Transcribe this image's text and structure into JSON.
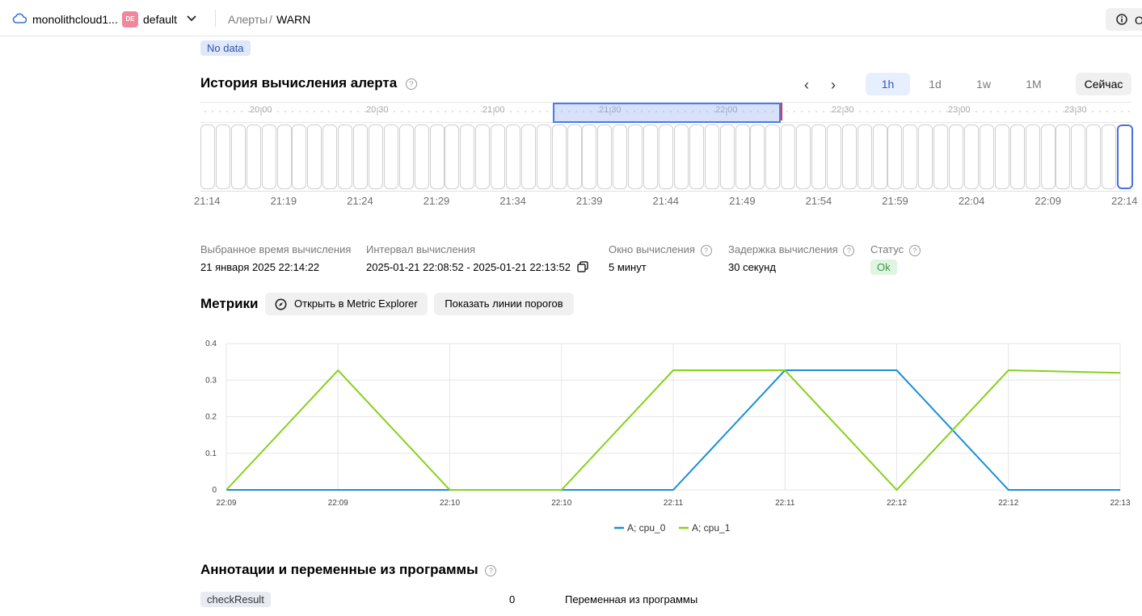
{
  "topbar": {
    "cloud_name": "monolithcloud1...",
    "folder_badge": "DE",
    "folder_name": "default",
    "crumb_parent": "Алерты",
    "crumb_sep": "/",
    "crumb_current": "WARN",
    "right_button": "O"
  },
  "status_no_data": "No data",
  "history": {
    "title": "История вычисления алерта",
    "periods": [
      "1h",
      "1d",
      "1w",
      "1M"
    ],
    "active_period": "1h",
    "now_button": "Сейчас",
    "timeline_labels": [
      "20:00",
      "20:30",
      "21:00",
      "21:30",
      "22:00",
      "22:30",
      "23:00",
      "23:30"
    ],
    "time_labels": [
      "21:14",
      "21:19",
      "21:24",
      "21:29",
      "21:34",
      "21:39",
      "21:44",
      "21:49",
      "21:54",
      "21:59",
      "22:04",
      "22:09",
      "22:14"
    ],
    "bar_count": 61
  },
  "details": {
    "selected_time_label": "Выбранное время вычисления",
    "selected_time_value": "21 января 2025 22:14:22",
    "interval_label": "Интервал вычисления",
    "interval_value": "2025-01-21 22:08:52 - 2025-01-21 22:13:52",
    "window_label": "Окно вычисления",
    "window_value": "5 минут",
    "delay_label": "Задержка вычисления",
    "delay_value": "30 секунд",
    "status_label": "Статус",
    "status_value": "Ok"
  },
  "metrics": {
    "title": "Метрики",
    "open_explorer": "Открыть в Metric Explorer",
    "show_thresholds": "Показать линии порогов"
  },
  "chart_data": {
    "type": "line",
    "x": [
      "22:09",
      "22:09",
      "22:10",
      "22:10",
      "22:11",
      "22:11",
      "22:12",
      "22:12",
      "22:13"
    ],
    "ylim": [
      0,
      0.4
    ],
    "yticks": [
      "0",
      "0.1",
      "0.2",
      "0.3",
      "0.4"
    ],
    "grid": true,
    "legend_position": "bottom",
    "series": [
      {
        "name": "A; cpu_0",
        "color": "#1a8fd8",
        "values": [
          0,
          0,
          0,
          0,
          0,
          0.327,
          0.327,
          0,
          0
        ]
      },
      {
        "name": "A; cpu_1",
        "color": "#86d11c",
        "values": [
          0,
          0.327,
          0,
          0,
          0.327,
          0.327,
          0,
          0.327,
          0.32
        ]
      }
    ]
  },
  "annotations": {
    "title": "Аннотации и переменные из программы",
    "rows": [
      {
        "name": "checkResult",
        "value": "0",
        "type": "Переменная из программы"
      }
    ]
  }
}
